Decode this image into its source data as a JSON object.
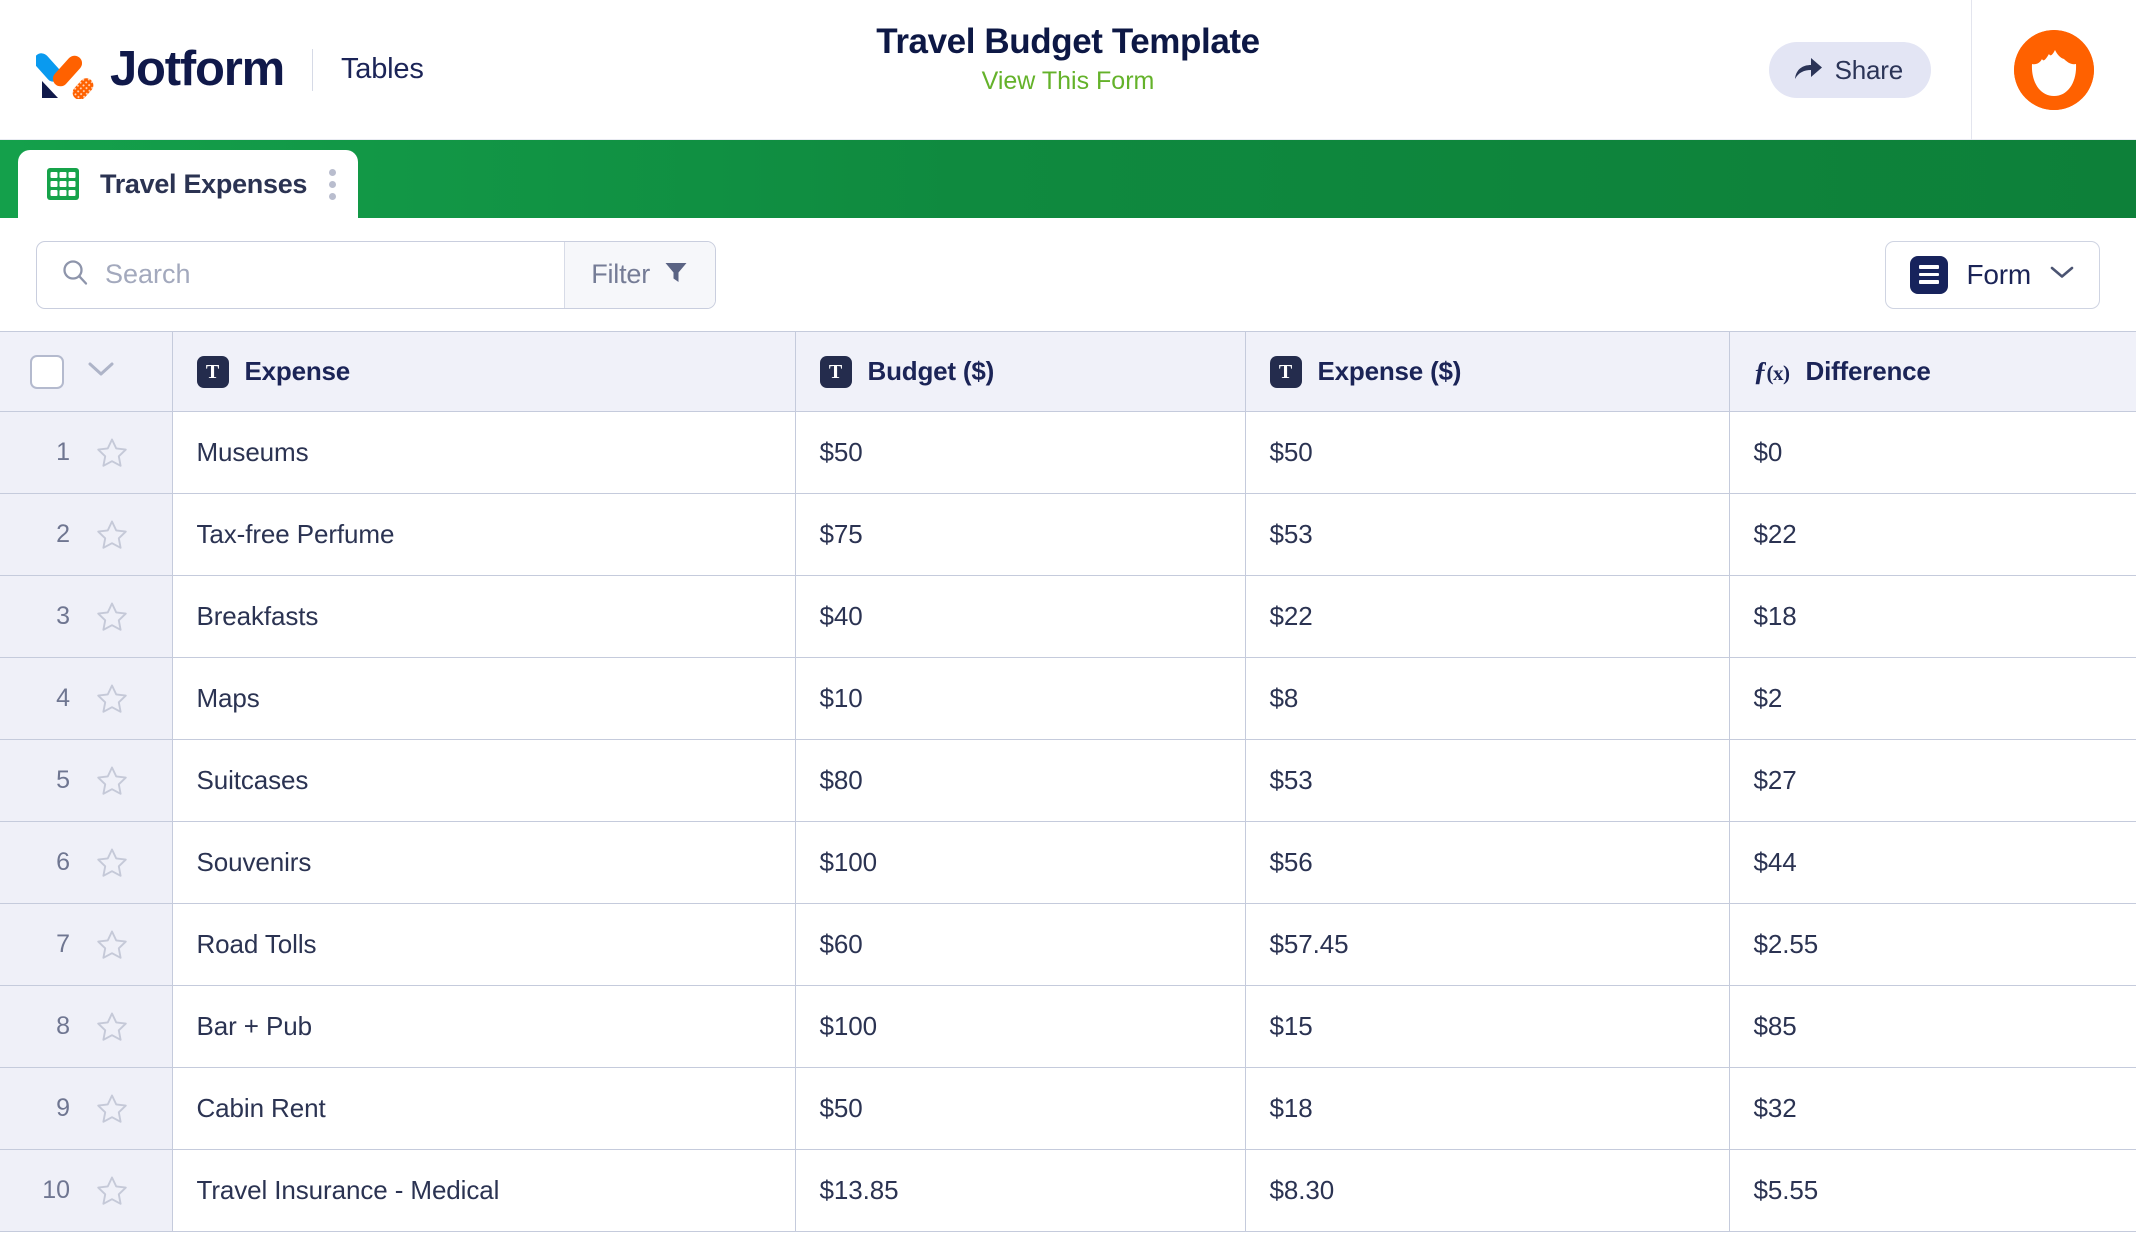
{
  "header": {
    "brand": "Jotform",
    "product": "Tables",
    "form_title": "Travel Budget Template",
    "form_subtitle": "View This Form",
    "share_label": "Share"
  },
  "tabbar": {
    "tabs": [
      {
        "label": "Travel Expenses",
        "icon": "table-grid-icon",
        "active": true
      }
    ]
  },
  "toolbar": {
    "search_value": "",
    "search_placeholder": "Search",
    "filter_label": "Filter",
    "form_label": "Form"
  },
  "table": {
    "columns": [
      {
        "label": "Expense",
        "type_icon": "text-type-icon"
      },
      {
        "label": "Budget ($)",
        "type_icon": "text-type-icon"
      },
      {
        "label": "Expense ($)",
        "type_icon": "text-type-icon"
      },
      {
        "label": "Difference",
        "type_icon": "formula-type-icon"
      }
    ],
    "rows": [
      {
        "n": "1",
        "expense": "Museums",
        "budget": "$50",
        "spent": "$50",
        "difference": "$0"
      },
      {
        "n": "2",
        "expense": "Tax-free Perfume",
        "budget": "$75",
        "spent": "$53",
        "difference": "$22"
      },
      {
        "n": "3",
        "expense": "Breakfasts",
        "budget": "$40",
        "spent": "$22",
        "difference": "$18"
      },
      {
        "n": "4",
        "expense": "Maps",
        "budget": "$10",
        "spent": "$8",
        "difference": "$2"
      },
      {
        "n": "5",
        "expense": "Suitcases",
        "budget": "$80",
        "spent": "$53",
        "difference": "$27"
      },
      {
        "n": "6",
        "expense": "Souvenirs",
        "budget": "$100",
        "spent": "$56",
        "difference": "$44"
      },
      {
        "n": "7",
        "expense": "Road Tolls",
        "budget": "$60",
        "spent": "$57.45",
        "difference": "$2.55"
      },
      {
        "n": "8",
        "expense": "Bar + Pub",
        "budget": "$100",
        "spent": "$15",
        "difference": "$85"
      },
      {
        "n": "9",
        "expense": "Cabin Rent",
        "budget": "$50",
        "spent": "$18",
        "difference": "$32"
      },
      {
        "n": "10",
        "expense": "Travel Insurance - Medical",
        "budget": "$13.85",
        "spent": "$8.30",
        "difference": "$5.55"
      }
    ]
  },
  "colors": {
    "brand_navy": "#10194a",
    "brand_orange": "#ff6100",
    "brand_blue": "#0a9aef",
    "tab_green": "#0f8a3f",
    "link_green": "#64b22a",
    "row_alt": "#eff0f8"
  }
}
